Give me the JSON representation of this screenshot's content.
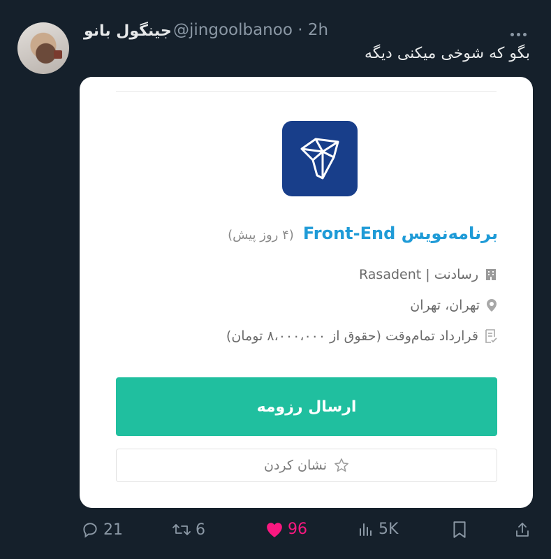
{
  "tweet": {
    "display_name": "جینگول بانو",
    "handle": "@jingoolbanoo",
    "time": "2h",
    "text": "بگو که شوخی میکنی دیگه"
  },
  "card": {
    "logo_icon": "tooth-logo-icon",
    "job_title": "برنامه‌نویس Front-End",
    "posted": "(۴ روز پیش)",
    "company": "رسادنت | Rasadent",
    "location": "تهران، تهران",
    "contract": "قرارداد تمام‌وقت (حقوق از ۸،۰۰۰،۰۰۰ تومان)",
    "apply_label": "ارسال رزومه",
    "bookmark_label": "نشان کردن",
    "colors": {
      "accent": "#20bf9f",
      "title": "#1f9bd7",
      "logo_bg": "#183e8a"
    }
  },
  "actions": {
    "replies": "21",
    "retweets": "6",
    "likes": "96",
    "views": "5K"
  }
}
